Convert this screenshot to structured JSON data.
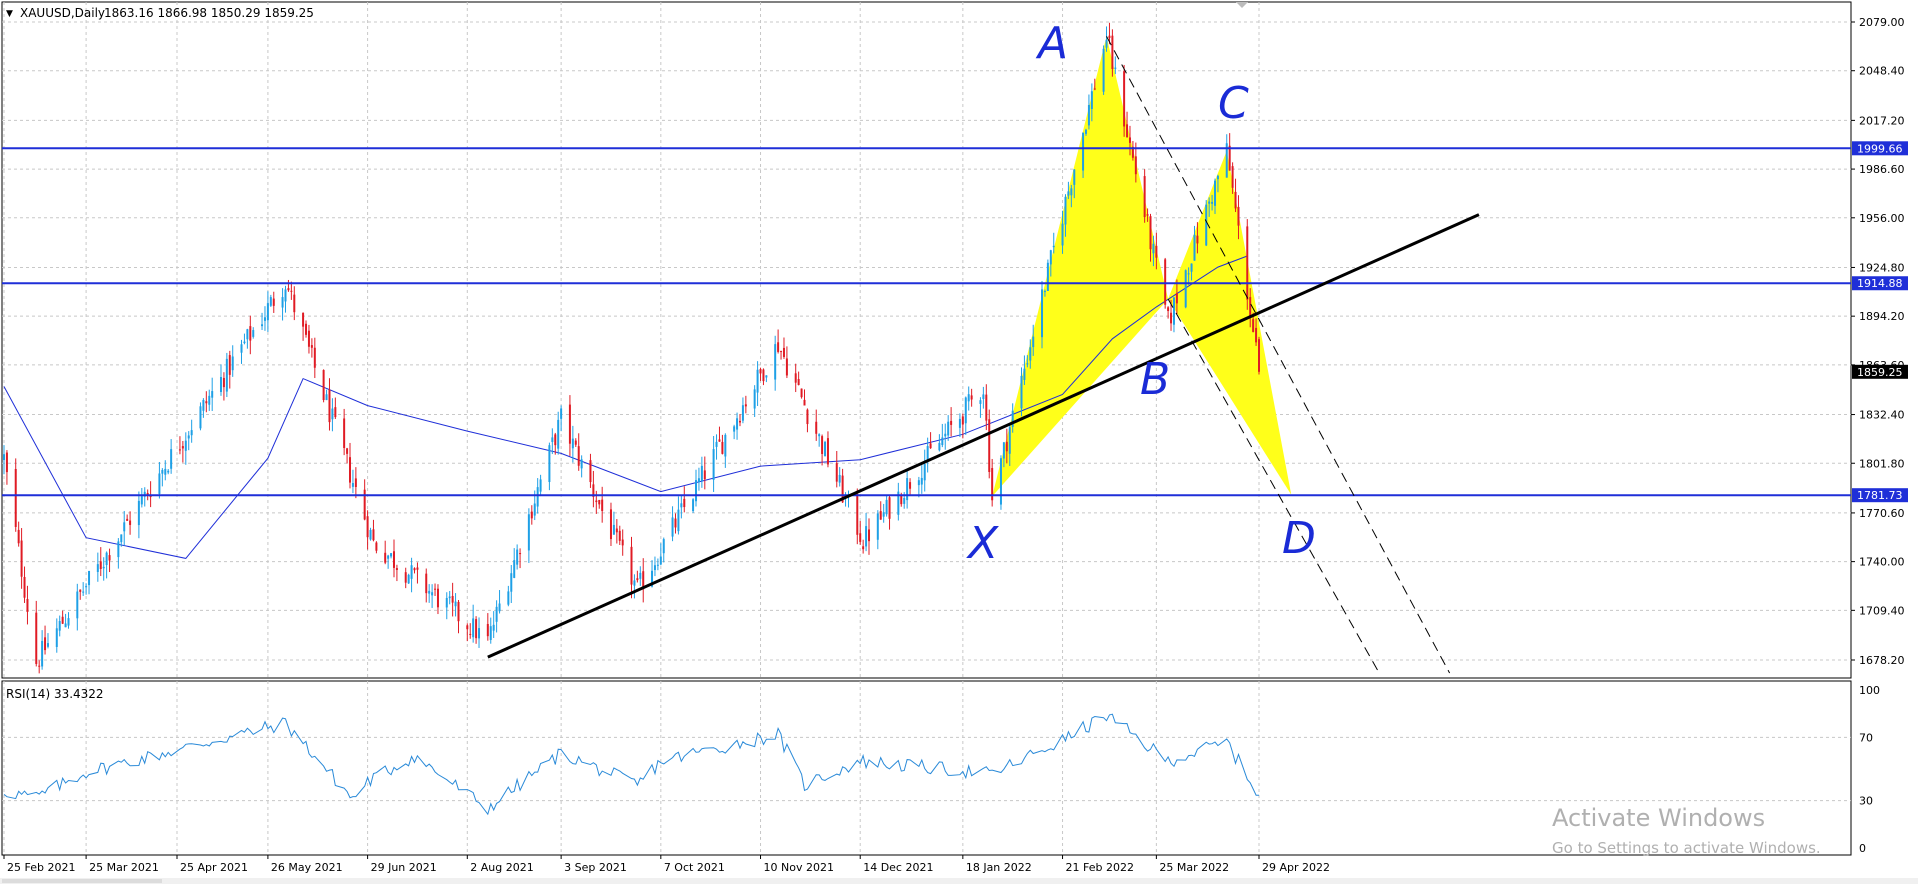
{
  "header": {
    "symbol": "XAUUSD,Daily",
    "ohlc": "1863.16 1866.98 1850.29 1859.25"
  },
  "rsi_header": "RSI(14) 33.4322",
  "watermark": {
    "title": "Activate Windows",
    "subtitle": "Go to Settings to activate Windows."
  },
  "pattern_labels": {
    "X": "X",
    "A": "A",
    "B": "B",
    "C": "C",
    "D": "D"
  },
  "colors": {
    "bull": "#1ea0e6",
    "bear": "#e01b24",
    "ma": "#1f2fd8",
    "level": "#1f2fd8",
    "pattern": "#ffff1a",
    "trend": "#000000",
    "rsi": "#2a8ad8",
    "grid": "#c8c8c8"
  },
  "chart_data": [
    {
      "type": "candlestick",
      "title": "XAUUSD,Daily",
      "x_ticks": [
        "25 Feb 2021",
        "25 Mar 2021",
        "25 Apr 2021",
        "26 May 2021",
        "29 Jun 2021",
        "2 Aug 2021",
        "3 Sep 2021",
        "7 Oct 2021",
        "10 Nov 2021",
        "14 Dec 2021",
        "18 Jan 2022",
        "21 Feb 2022",
        "25 Mar 2022",
        "29 Apr 2022"
      ],
      "y_ticks": [
        2079.0,
        2048.4,
        2017.2,
        1986.6,
        1956.0,
        1924.8,
        1894.2,
        1863.6,
        1832.4,
        1801.8,
        1770.6,
        1740.0,
        1709.4,
        1678.2
      ],
      "ylim": [
        1665,
        2090
      ],
      "last_price": 1859.25,
      "key_points": [
        {
          "date": "25 Feb 2021",
          "price": 1805
        },
        {
          "date": "8 Mar 2021",
          "price": 1677
        },
        {
          "date": "1 Jun 2021",
          "price": 1916
        },
        {
          "date": "1 Jul 2021",
          "price": 1752
        },
        {
          "date": "9 Aug 2021",
          "price": 1690
        },
        {
          "date": "3 Sep 2021",
          "price": 1830
        },
        {
          "date": "29 Sep 2021",
          "price": 1722
        },
        {
          "date": "16 Nov 2021",
          "price": 1877
        },
        {
          "date": "15 Dec 2021",
          "price": 1753
        },
        {
          "date": "25 Jan 2022",
          "price": 1850
        },
        {
          "date": "28 Jan 2022",
          "price": 1780
        },
        {
          "date": "8 Mar 2022",
          "price": 2070
        },
        {
          "date": "29 Mar 2022",
          "price": 1890
        },
        {
          "date": "18 Apr 2022",
          "price": 1998
        },
        {
          "date": "29 Apr 2022",
          "price": 1859.25
        }
      ],
      "moving_average": [
        {
          "date": "25 Feb 2021",
          "price": 1850
        },
        {
          "date": "25 Mar 2021",
          "price": 1755
        },
        {
          "date": "28 Apr 2021",
          "price": 1742
        },
        {
          "date": "26 May 2021",
          "price": 1805
        },
        {
          "date": "7 Jun 2021",
          "price": 1855
        },
        {
          "date": "29 Jun 2021",
          "price": 1838
        },
        {
          "date": "2 Aug 2021",
          "price": 1822
        },
        {
          "date": "3 Sep 2021",
          "price": 1808
        },
        {
          "date": "7 Oct 2021",
          "price": 1784
        },
        {
          "date": "10 Nov 2021",
          "price": 1800
        },
        {
          "date": "14 Dec 2021",
          "price": 1804
        },
        {
          "date": "18 Jan 2022",
          "price": 1820
        },
        {
          "date": "21 Feb 2022",
          "price": 1845
        },
        {
          "date": "10 Mar 2022",
          "price": 1880
        },
        {
          "date": "25 Mar 2022",
          "price": 1900
        },
        {
          "date": "15 Apr 2022",
          "price": 1925
        },
        {
          "date": "25 Apr 2022",
          "price": 1932
        }
      ],
      "horizontal_levels": [
        {
          "price": 1999.66,
          "label": "1999.66"
        },
        {
          "price": 1914.88,
          "label": "1914.88"
        },
        {
          "price": 1781.73,
          "label": "1781.73"
        }
      ],
      "trend_line": {
        "from": {
          "date": "9 Aug 2021",
          "price": 1680
        },
        "to": {
          "date": "13 Jul 2022",
          "price": 1958
        }
      },
      "harmonic_pattern": {
        "X": {
          "date": "28 Jan 2022",
          "price": 1781
        },
        "A": {
          "date": "8 Mar 2022",
          "price": 2070
        },
        "B": {
          "date": "29 Mar 2022",
          "price": 1905
        },
        "C": {
          "date": "18 Apr 2022",
          "price": 1998
        },
        "D": {
          "date": "10 May 2022",
          "price": 1782
        }
      },
      "channel_lines": [
        {
          "from": {
            "date": "8 Mar 2022",
            "price": 2070
          },
          "to": {
            "date": "3 Jul 2022",
            "price": 1670
          }
        },
        {
          "from": {
            "date": "29 Mar 2022",
            "price": 1905
          },
          "to": {
            "date": "9 Jun 2022",
            "price": 1670
          }
        }
      ]
    },
    {
      "type": "line",
      "title": "RSI(14) 33.4322",
      "ylim": [
        0,
        100
      ],
      "y_ticks": [
        100,
        70,
        30,
        0
      ],
      "last_value": 33.4322,
      "key_points": [
        {
          "date": "25 Feb 2021",
          "value": 36
        },
        {
          "date": "8 Mar 2021",
          "value": 32
        },
        {
          "date": "25 Mar 2021",
          "value": 48
        },
        {
          "date": "25 Apr 2021",
          "value": 62
        },
        {
          "date": "1 Jun 2021",
          "value": 79
        },
        {
          "date": "24 Jun 2021",
          "value": 31
        },
        {
          "date": "29 Jun 2021",
          "value": 42
        },
        {
          "date": "15 Jul 2021",
          "value": 58
        },
        {
          "date": "9 Aug 2021",
          "value": 25
        },
        {
          "date": "3 Sep 2021",
          "value": 60
        },
        {
          "date": "29 Sep 2021",
          "value": 40
        },
        {
          "date": "7 Oct 2021",
          "value": 55
        },
        {
          "date": "16 Nov 2021",
          "value": 72
        },
        {
          "date": "25 Nov 2021",
          "value": 40
        },
        {
          "date": "14 Dec 2021",
          "value": 55
        },
        {
          "date": "28 Jan 2022",
          "value": 47
        },
        {
          "date": "21 Feb 2022",
          "value": 68
        },
        {
          "date": "8 Mar 2022",
          "value": 84
        },
        {
          "date": "29 Mar 2022",
          "value": 55
        },
        {
          "date": "18 Apr 2022",
          "value": 67
        },
        {
          "date": "29 Apr 2022",
          "value": 33.43
        }
      ]
    }
  ]
}
